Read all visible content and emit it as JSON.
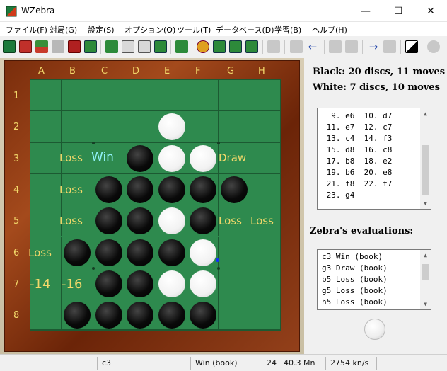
{
  "window": {
    "title": "WZebra",
    "minimize": "—",
    "maximize": "☐",
    "close": "✕"
  },
  "menu": [
    "ファイル(F)",
    "対局(G)",
    "設定(S)",
    "オプション(O)",
    "ツール(T)",
    "データベース(D)",
    "学習(B)",
    "ヘルプ(H)"
  ],
  "board": {
    "columns": [
      "A",
      "B",
      "C",
      "D",
      "E",
      "F",
      "G",
      "H"
    ],
    "rows": [
      "1",
      "2",
      "3",
      "4",
      "5",
      "6",
      "7",
      "8"
    ],
    "evals": {
      "b3": "Loss",
      "c3": "Win",
      "g3": "Draw",
      "b4": "Loss",
      "b5": "Loss",
      "g5": "Loss",
      "h5": "Loss",
      "a6": "Loss",
      "a7": "-14",
      "b7": "-16"
    }
  },
  "score": {
    "black": "Black:  20 discs, 11 moves",
    "white": "White:  7 discs, 10 moves"
  },
  "moves": [
    "  9. e6  10. d7",
    " 11. e7  12. c7",
    " 13. c4  14. f3",
    " 15. d8  16. c8",
    " 17. b8  18. e2",
    " 19. b6  20. e8",
    " 21. f8  22. f7",
    " 23. g4"
  ],
  "evaluations_title": "Zebra's evaluations:",
  "evaluations": [
    "c3 Win (book)",
    "g3 Draw (book)",
    "b5 Loss (book)",
    "g5 Loss (book)",
    "h5 Loss (book)"
  ],
  "status": {
    "move": "c3",
    "result": "Win (book)",
    "depth": "24",
    "nodes": "40.3 Mn",
    "speed": "2754 kn/s"
  },
  "colors": {
    "board_green": "#2e8a4e",
    "eval_text": "#f2d86a",
    "win_text": "#8ff0f5",
    "frame": "#8a3712"
  }
}
